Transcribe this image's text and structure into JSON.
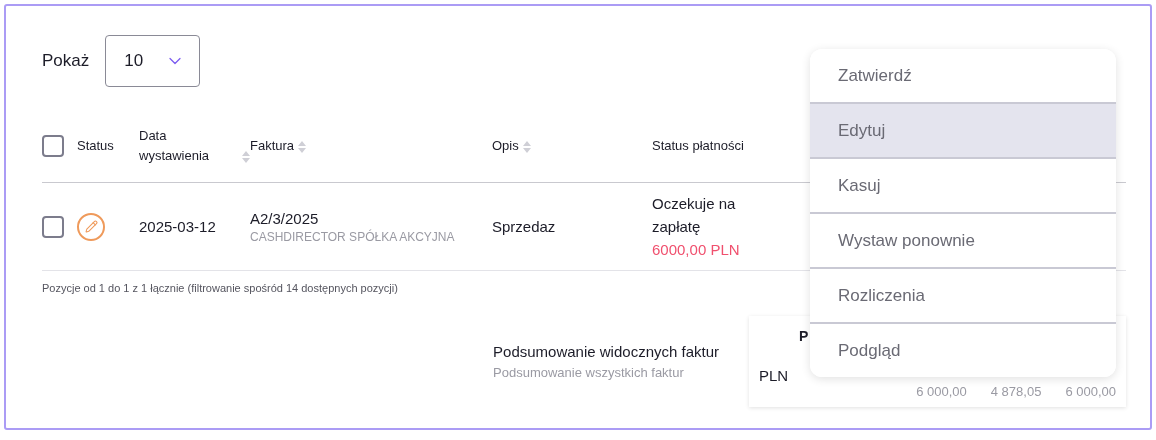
{
  "page_size": {
    "label": "Pokaż",
    "value": "10"
  },
  "table": {
    "select_all": {
      "checked": false
    },
    "columns": [
      {
        "label": "Status",
        "sortable": false
      },
      {
        "label": "Data wystawienia",
        "sortable": true
      },
      {
        "label": "Faktura",
        "sortable": true
      },
      {
        "label": "Opis",
        "sortable": true
      },
      {
        "label": "Status płatności",
        "sortable": false
      }
    ],
    "rows": [
      {
        "checked": false,
        "date": "2025-03-12",
        "invoice": "A2/3/2025",
        "company": "CASHDIRECTOR SPÓŁKA AKCYJNA",
        "description": "Sprzedaz",
        "payment_status": "Oczekuje na zapłatę",
        "payment_amount": "6000,00 PLN"
      }
    ]
  },
  "footer": "Pozycje od 1 do 1 z 1 łącznie (filtrowanie spośród 14 dostępnych pozycji)",
  "summary": {
    "title": "Podsumowanie widocznych faktur",
    "subtitle": "Podsumowanie wszystkich faktur",
    "table": {
      "header": "P",
      "currency": "PLN",
      "values": [
        "6 000,00",
        "4 878,05",
        "6 000,00"
      ]
    }
  },
  "menu": {
    "items": [
      {
        "label": "Zatwierdź",
        "selected": false
      },
      {
        "label": "Edytuj",
        "selected": true
      },
      {
        "label": "Kasuj",
        "selected": false
      },
      {
        "label": "Wystaw ponownie",
        "selected": false
      },
      {
        "label": "Rozliczenia",
        "selected": false
      },
      {
        "label": "Podgląd",
        "selected": false
      }
    ]
  }
}
